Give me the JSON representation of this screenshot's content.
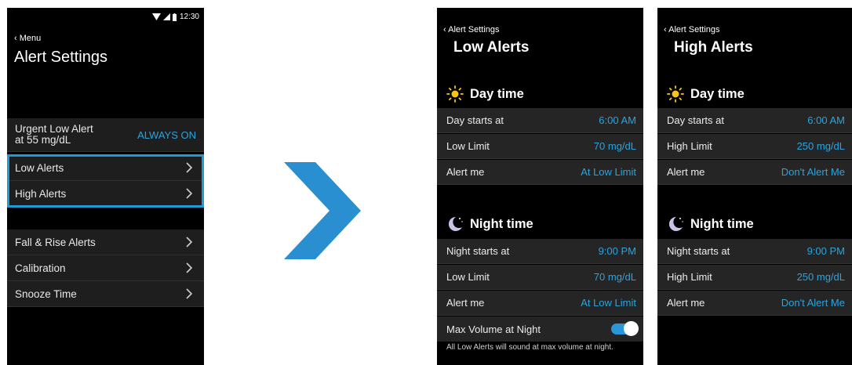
{
  "menu_screen": {
    "status_time": "12:30",
    "back_label": "Menu",
    "title": "Alert Settings",
    "urgent": {
      "label_line1": "Urgent Low Alert",
      "label_line2": "at 55 mg/dL",
      "value": "ALWAYS ON"
    },
    "items": [
      {
        "label": "Low Alerts"
      },
      {
        "label": "High Alerts"
      },
      {
        "label": "Fall & Rise Alerts"
      },
      {
        "label": "Calibration"
      },
      {
        "label": "Snooze Time"
      }
    ]
  },
  "low_alerts_screen": {
    "back_label": "Alert Settings",
    "title": "Low Alerts",
    "day_title": "Day time",
    "day_rows": [
      {
        "label": "Day starts at",
        "value": "6:00 AM"
      },
      {
        "label": "Low Limit",
        "value": "70 mg/dL"
      },
      {
        "label": "Alert me",
        "value": "At Low Limit"
      }
    ],
    "night_title": "Night time",
    "night_rows": [
      {
        "label": "Night starts at",
        "value": "9:00 PM"
      },
      {
        "label": "Low Limit",
        "value": "70 mg/dL"
      },
      {
        "label": "Alert me",
        "value": "At Low Limit"
      }
    ],
    "max_volume_label": "Max Volume at Night",
    "max_volume_on": true,
    "footnote": "All Low Alerts will sound at max volume at night."
  },
  "high_alerts_screen": {
    "back_label": "Alert Settings",
    "title": "High Alerts",
    "day_title": "Day time",
    "day_rows": [
      {
        "label": "Day starts at",
        "value": "6:00 AM"
      },
      {
        "label": "High Limit",
        "value": "250 mg/dL"
      },
      {
        "label": "Alert me",
        "value": "Don't Alert Me"
      }
    ],
    "night_title": "Night time",
    "night_rows": [
      {
        "label": "Night starts at",
        "value": "9:00 PM"
      },
      {
        "label": "High Limit",
        "value": "250 mg/dL"
      },
      {
        "label": "Alert me",
        "value": "Don't Alert Me"
      }
    ]
  },
  "colors": {
    "accent": "#2aa4e0",
    "highlight": "#1e9ad6",
    "arrow": "#2a8fd0",
    "sun": "#f5c518"
  },
  "icons": [
    "wifi-icon",
    "signal-icon",
    "battery-icon",
    "back-chevron-icon",
    "chevron-right-icon",
    "sun-icon",
    "moon-icon",
    "next-arrow-icon"
  ]
}
